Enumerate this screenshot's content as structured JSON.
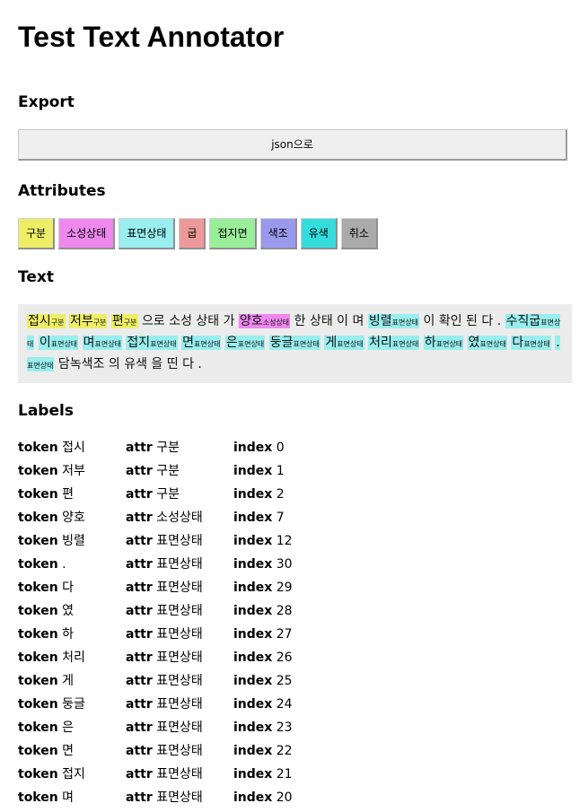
{
  "app": {
    "title": "Test Text Annotator"
  },
  "export": {
    "heading": "Export",
    "json_button": "json으로"
  },
  "attributes": {
    "heading": "Attributes",
    "buttons": [
      {
        "label": "구분",
        "color": "#eeee66"
      },
      {
        "label": "소성상태",
        "color": "#ee88ee"
      },
      {
        "label": "표면상태",
        "color": "#99eeee"
      },
      {
        "label": "굽",
        "color": "#ee9999"
      },
      {
        "label": "접지면",
        "color": "#99ee99"
      },
      {
        "label": "색조",
        "color": "#9999ee"
      },
      {
        "label": "유색",
        "color": "#33dddd"
      },
      {
        "label": "취소",
        "color": "#aaaaaa"
      }
    ]
  },
  "text": {
    "heading": "Text",
    "segments": [
      {
        "t": "접시",
        "tag": "구분",
        "color": "#eeee66"
      },
      {
        "t": " "
      },
      {
        "t": "저부",
        "tag": "구분",
        "color": "#eeee66"
      },
      {
        "t": " "
      },
      {
        "t": "편",
        "tag": "구분",
        "color": "#eeee66"
      },
      {
        "t": " 으로 소성 상태 가 "
      },
      {
        "t": "양호",
        "tag": "소성상태",
        "color": "#ee88ee"
      },
      {
        "t": " 한 상태 이 며 "
      },
      {
        "t": "빙렬",
        "tag": "표면상태",
        "color": "#99eeee"
      },
      {
        "t": " 이 확인 된 다 . "
      },
      {
        "t": "수직굽",
        "tag": "표면상태",
        "color": "#99eeee"
      },
      {
        "t": " "
      },
      {
        "t": "이",
        "tag": "표면상태",
        "color": "#99eeee"
      },
      {
        "t": " "
      },
      {
        "t": "며",
        "tag": "표면상태",
        "color": "#99eeee"
      },
      {
        "t": " "
      },
      {
        "t": "접지",
        "tag": "표면상태",
        "color": "#99eeee"
      },
      {
        "t": " "
      },
      {
        "t": "면",
        "tag": "표면상태",
        "color": "#99eeee"
      },
      {
        "t": " "
      },
      {
        "t": "은",
        "tag": "표면상태",
        "color": "#99eeee"
      },
      {
        "t": " "
      },
      {
        "t": "둥글",
        "tag": "표면상태",
        "color": "#99eeee"
      },
      {
        "t": " "
      },
      {
        "t": "게",
        "tag": "표면상태",
        "color": "#99eeee"
      },
      {
        "t": " "
      },
      {
        "t": "처리",
        "tag": "표면상태",
        "color": "#99eeee"
      },
      {
        "t": " "
      },
      {
        "t": "하",
        "tag": "표면상태",
        "color": "#99eeee"
      },
      {
        "t": " "
      },
      {
        "t": "였",
        "tag": "표면상태",
        "color": "#99eeee"
      },
      {
        "t": " "
      },
      {
        "t": "다",
        "tag": "표면상태",
        "color": "#99eeee"
      },
      {
        "t": " "
      },
      {
        "t": ".",
        "tag": "표면상태",
        "color": "#99eeee"
      },
      {
        "t": " 담녹색조 의 유색 을 띤 다 ."
      }
    ]
  },
  "labels": {
    "heading": "Labels",
    "token_key": "token",
    "attr_key": "attr",
    "index_key": "index",
    "rows": [
      {
        "token": "접시",
        "attr": "구분",
        "index": "0"
      },
      {
        "token": "저부",
        "attr": "구분",
        "index": "1"
      },
      {
        "token": "편",
        "attr": "구분",
        "index": "2"
      },
      {
        "token": "양호",
        "attr": "소성상태",
        "index": "7"
      },
      {
        "token": "빙렬",
        "attr": "표면상태",
        "index": "12"
      },
      {
        "token": ".",
        "attr": "표면상태",
        "index": "30"
      },
      {
        "token": "다",
        "attr": "표면상태",
        "index": "29"
      },
      {
        "token": "였",
        "attr": "표면상태",
        "index": "28"
      },
      {
        "token": "하",
        "attr": "표면상태",
        "index": "27"
      },
      {
        "token": "처리",
        "attr": "표면상태",
        "index": "26"
      },
      {
        "token": "게",
        "attr": "표면상태",
        "index": "25"
      },
      {
        "token": "둥글",
        "attr": "표면상태",
        "index": "24"
      },
      {
        "token": "은",
        "attr": "표면상태",
        "index": "23"
      },
      {
        "token": "면",
        "attr": "표면상태",
        "index": "22"
      },
      {
        "token": "접지",
        "attr": "표면상태",
        "index": "21"
      },
      {
        "token": "며",
        "attr": "표면상태",
        "index": "20"
      }
    ]
  }
}
